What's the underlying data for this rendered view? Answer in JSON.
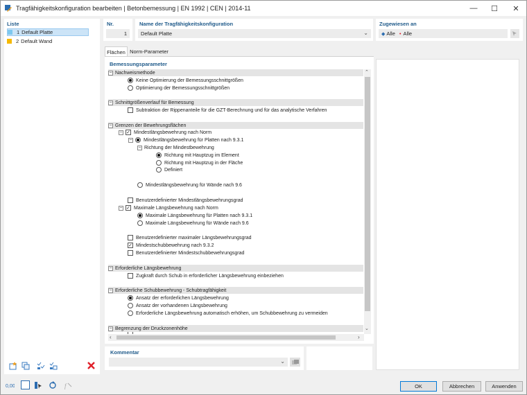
{
  "window": {
    "title": "Tragfähigkeitskonfiguration bearbeiten | Betonbemessung | EN 1992 | CEN | 2014-11",
    "minimize": "—",
    "maximize": "☐",
    "close": "✕"
  },
  "list": {
    "header": "Liste",
    "items": [
      {
        "number": "1",
        "name": "Default Platte",
        "color": "#7ec8ef"
      },
      {
        "number": "2",
        "name": "Default Wand",
        "color": "#f5b800"
      }
    ]
  },
  "fields": {
    "nr_label": "Nr.",
    "nr_value": "1",
    "name_label": "Name der Tragfähigkeitskonfiguration",
    "name_value": "Default Platte",
    "assign_label": "Zugewiesen an",
    "assign_all_1": "Alle",
    "assign_all_2": "Alle"
  },
  "tabs": [
    "Flächen",
    "Norm-Parameter"
  ],
  "params": {
    "header": "Bemessungsparameter",
    "groups": {
      "g1": "Nachweismethode",
      "g2": "Schnittgrößenverlauf für Bemessung",
      "g3": "Grenzen der Bewehrungsflächen",
      "g4": "Erforderliche Längsbewehrung",
      "g5": "Erforderliche Schubbewehrung - Schubtragfähigkeit",
      "g6": "Begrenzung der Druckzonenhöhe"
    },
    "items": {
      "r1": "Keine Optimierung der Bemessungsschnittgrößen",
      "r2": "Optimierung der Bemessungsschnittgrößen",
      "c1": "Subtraktion der Rippenanteile für die GZT-Berechnung und für das analytische Verfahren",
      "c2": "Mindestlängsbewehrung nach Norm",
      "r3": "Mindestlängsbewehrung für Platten nach 9.3.1",
      "sub1": "Richtung der Mindestbewehrung",
      "r4": "Richtung mit Hauptzug im Element",
      "r5": "Richtung mit Hauptzug in der Fläche",
      "r6": "Definiert",
      "r7": "Mindestlängsbewehrung für Wände nach 9.6",
      "c3": "Benutzerdefinierter Mindestlängsbewehrungsgrad",
      "c4": "Maximale Längsbewehrung nach Norm",
      "r8": "Maximale Längsbewehrung für Platten nach 9.3.1",
      "r9": "Maximale Längsbewehrung für Wände nach 9.6",
      "c5": "Benutzerdefinierter maximaler Längsbewehrungsgrad",
      "c6": "Mindestschubbewehrung nach 9.3.2",
      "c7": "Benutzerdefinierter Mindestschubbewehrungsgrad",
      "c8": "Zugkraft durch Schub in erforderlicher Längsbewehrung einbeziehen",
      "r10": "Ansatz der erforderlichen Längsbewehrung",
      "r11": "Ansatz der vorhandenen Längsbewehrung",
      "r12": "Erforderliche Längsbewehrung automatisch erhöhen, um Schubbewehrung zu vermeiden"
    }
  },
  "comment": {
    "label": "Kommentar",
    "value": ""
  },
  "buttons": {
    "ok": "OK",
    "cancel": "Abbrechen",
    "apply": "Anwenden"
  },
  "colors": {
    "accent": "#1f5a8a",
    "selection": "#cce4f7",
    "delete": "#e0202a",
    "primary_border": "#0078d7"
  }
}
